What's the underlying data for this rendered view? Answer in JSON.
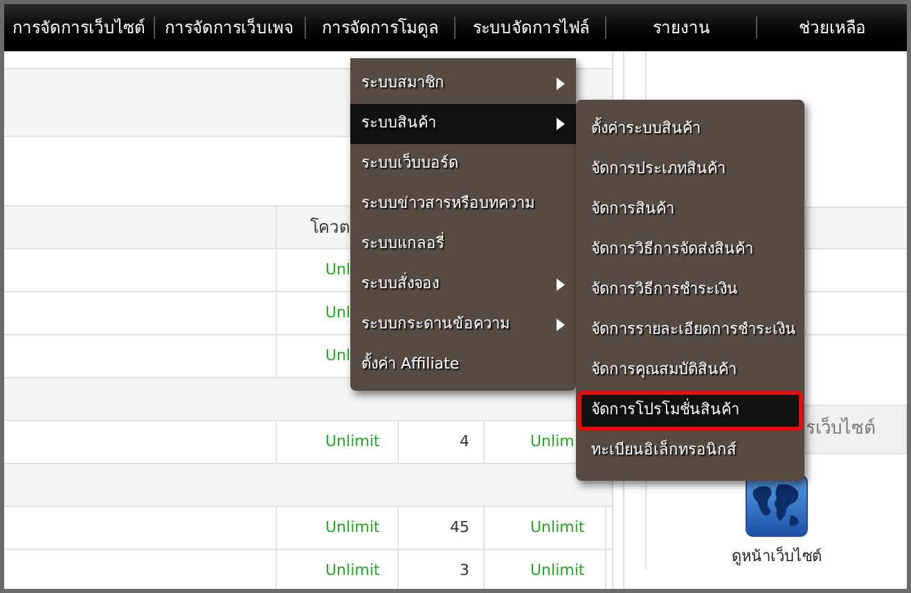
{
  "nav": [
    {
      "label": "การจัดการเว็บไซต์"
    },
    {
      "label": "การจัดการเว็บเพจ"
    },
    {
      "label": "การจัดการโมดูล"
    },
    {
      "label": "ระบบจัดการไฟล์"
    },
    {
      "label": "รายงาน"
    },
    {
      "label": "ช่วยเหลือ"
    }
  ],
  "menu": {
    "items": [
      {
        "label": "ระบบสมาชิก",
        "has_submenu": true,
        "selected": false
      },
      {
        "label": "ระบบสินค้า",
        "has_submenu": true,
        "selected": true
      },
      {
        "label": "ระบบเว็บบอร์ด",
        "has_submenu": false,
        "selected": false
      },
      {
        "label": "ระบบข่าวสารหรือบทความ",
        "has_submenu": false,
        "selected": false
      },
      {
        "label": "ระบบแกลอรี่",
        "has_submenu": false,
        "selected": false
      },
      {
        "label": "ระบบสั่งจอง",
        "has_submenu": true,
        "selected": false
      },
      {
        "label": "ระบบกระดานข้อความ",
        "has_submenu": true,
        "selected": false
      },
      {
        "label": "ตั้งค่า Affiliate",
        "has_submenu": false,
        "selected": false
      }
    ]
  },
  "submenu": {
    "items": [
      {
        "label": "ตั้งค่าระบบสินค้า",
        "selected": false
      },
      {
        "label": "จัดการประเภทสินค้า",
        "selected": false
      },
      {
        "label": "จัดการสินค้า",
        "selected": false
      },
      {
        "label": "จัดการวิธีการจัดส่งสินค้า",
        "selected": false
      },
      {
        "label": "จัดการวิธีการชำระเงิน",
        "selected": false
      },
      {
        "label": "จัดการรายละเอียดการชำระเงิน",
        "selected": false
      },
      {
        "label": "จัดการคุณสมบัติสินค้า",
        "selected": false
      },
      {
        "label": "จัดการโปรโมชั่นสินค้า",
        "selected": true
      },
      {
        "label": "ทะเบียนอิเล็กทรอนิกส์",
        "selected": false
      }
    ]
  },
  "table": {
    "columns": [
      "โควต"
    ],
    "rows": [
      {
        "kind": "data",
        "cells": [
          "Unl"
        ]
      },
      {
        "kind": "data",
        "cells": [
          "Unl"
        ]
      },
      {
        "kind": "data",
        "cells": [
          "Unl"
        ]
      },
      {
        "kind": "section"
      },
      {
        "kind": "data",
        "cells": [
          "Unlimit",
          "4",
          "Unlim"
        ]
      },
      {
        "kind": "section"
      },
      {
        "kind": "data",
        "cells": [
          "Unlimit",
          "45",
          "Unlimit"
        ]
      },
      {
        "kind": "data",
        "cells": [
          "Unlimit",
          "3",
          "Unlimit"
        ]
      }
    ]
  },
  "site_panel": {
    "title": "รเว็บไซต์",
    "shortcut": "ดูหน้าเว็บไซต์"
  }
}
